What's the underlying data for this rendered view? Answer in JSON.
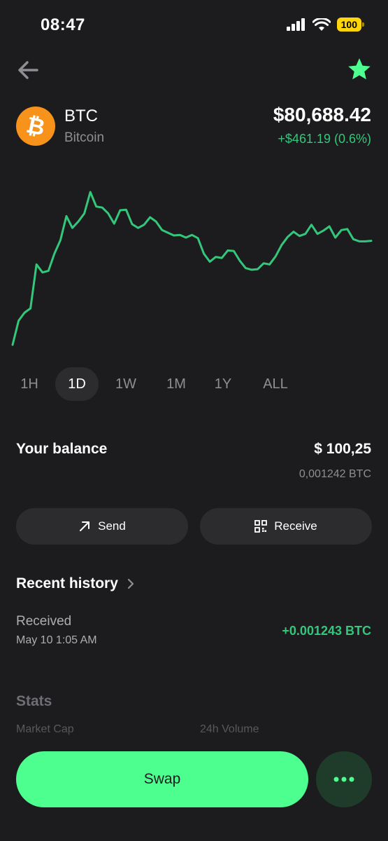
{
  "status_bar": {
    "time": "08:47",
    "battery": "100"
  },
  "asset": {
    "ticker": "BTC",
    "name": "Bitcoin",
    "price": "$80,688.42",
    "change": "+$461.19 (0.6%)"
  },
  "chart_data": {
    "type": "line",
    "title": "",
    "xlabel": "",
    "ylabel": "",
    "color": "#34c77b",
    "y": [
      80410,
      80455,
      80470,
      80478,
      80560,
      80545,
      80548,
      80580,
      80605,
      80650,
      80628,
      80640,
      80655,
      80695,
      80668,
      80666,
      80655,
      80636,
      80661,
      80662,
      80635,
      80628,
      80634,
      80648,
      80640,
      80624,
      80619,
      80614,
      80615,
      80610,
      80615,
      80609,
      80580,
      80565,
      80574,
      80572,
      80586,
      80585,
      80567,
      80553,
      80550,
      80551,
      80562,
      80560,
      80575,
      80596,
      80611,
      80621,
      80613,
      80617,
      80634,
      80617,
      80623,
      80631,
      80610,
      80624,
      80626,
      80607,
      80603,
      80603,
      80604
    ],
    "grid": false
  },
  "timeframes": [
    "1H",
    "1D",
    "1W",
    "1M",
    "1Y",
    "ALL"
  ],
  "selected_timeframe": "1D",
  "balance": {
    "label": "Your balance",
    "usd": "$ 100,25",
    "btc": "0,001242 BTC"
  },
  "actions": {
    "send": "Send",
    "receive": "Receive"
  },
  "history": {
    "title": "Recent history",
    "items": [
      {
        "type": "Received",
        "date": "May 10 1:05 AM",
        "amount": "+0.001243 BTC"
      }
    ]
  },
  "stats": {
    "title": "Stats",
    "market_cap_label": "Market Cap",
    "volume_label": "24h Volume"
  },
  "bottom": {
    "swap_label": "Swap"
  },
  "colors": {
    "accent": "#4cff8f",
    "positive": "#34c77b",
    "bitcoin": "#f7931a",
    "background": "#1c1c1e"
  },
  "icons": [
    "arrow-left-icon",
    "star-icon",
    "bitcoin-logo-icon",
    "arrow-up-right-icon",
    "qr-code-icon",
    "chevron-right-icon",
    "more-dots-icon"
  ]
}
